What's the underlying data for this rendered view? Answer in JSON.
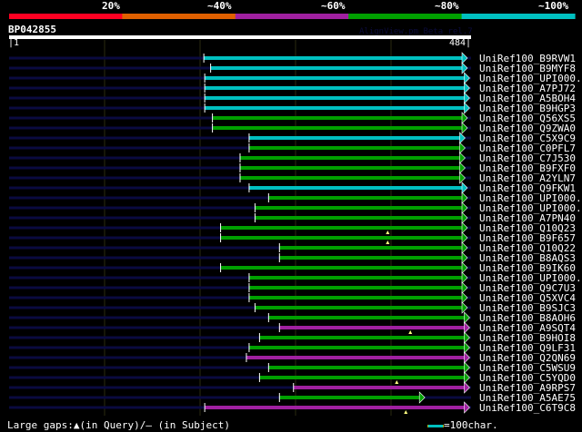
{
  "header": {
    "percent_labels": [
      "20%",
      "~40%",
      "~60%",
      "~80%",
      "~100%"
    ],
    "percent_colors": [
      "#ff0022",
      "#e06000",
      "#a020a0",
      "#00a000",
      "#00c0c0"
    ],
    "query_name": "BP042855",
    "credit": "AlignView.pm Beta rel.7",
    "start": "|1",
    "end": "484|"
  },
  "colors": {
    "cyan": "#00c0c0",
    "green": "#00a000",
    "magenta": "#a020a0",
    "dark": "#0a0a40",
    "grid": "#2a2a10"
  },
  "hits": [
    {
      "name": "UniRef100_B9RVW1",
      "start": 0.43,
      "end": 1.0,
      "color": "cyan"
    },
    {
      "name": "UniRef100_B9MYF8",
      "start": 0.445,
      "end": 1.0,
      "color": "cyan"
    },
    {
      "name": "UniRef100_UPI000..",
      "start": 0.432,
      "end": 1.005,
      "color": "cyan"
    },
    {
      "name": "UniRef100_A7PJ72",
      "start": 0.432,
      "end": 1.005,
      "color": "cyan"
    },
    {
      "name": "UniRef100_A5BOH4",
      "start": 0.432,
      "end": 1.005,
      "color": "cyan"
    },
    {
      "name": "UniRef100_B9HGP3",
      "start": 0.432,
      "end": 1.005,
      "color": "cyan"
    },
    {
      "name": "UniRef100_Q56XS5",
      "start": 0.449,
      "end": 1.0,
      "color": "green"
    },
    {
      "name": "UniRef100_Q9ZWA0",
      "start": 0.449,
      "end": 1.0,
      "color": "green"
    },
    {
      "name": "UniRef100_C5X9C9",
      "start": 0.53,
      "end": 0.995,
      "color": "cyan"
    },
    {
      "name": "UniRef100_C0PFL7",
      "start": 0.53,
      "end": 0.995,
      "color": "green"
    },
    {
      "name": "UniRef100_C7J530",
      "start": 0.51,
      "end": 0.995,
      "color": "green"
    },
    {
      "name": "UniRef100_B9FXF0",
      "start": 0.51,
      "end": 0.995,
      "color": "green"
    },
    {
      "name": "UniRef100_A2YLN7",
      "start": 0.51,
      "end": 0.995,
      "color": "green"
    },
    {
      "name": "UniRef100_Q9FKW1",
      "start": 0.53,
      "end": 1.0,
      "color": "cyan"
    },
    {
      "name": "UniRef100_UPI000..",
      "start": 0.573,
      "end": 1.0,
      "color": "green"
    },
    {
      "name": "UniRef100_UPI000..",
      "start": 0.543,
      "end": 1.0,
      "color": "green"
    },
    {
      "name": "UniRef100_A7PN40",
      "start": 0.543,
      "end": 1.0,
      "color": "green"
    },
    {
      "name": "UniRef100_Q10Q23",
      "start": 0.467,
      "end": 1.0,
      "color": "green",
      "gap": 0.836
    },
    {
      "name": "UniRef100_B9F657",
      "start": 0.467,
      "end": 1.0,
      "color": "green",
      "gap": 0.836
    },
    {
      "name": "UniRef100_Q10Q22",
      "start": 0.597,
      "end": 1.0,
      "color": "green"
    },
    {
      "name": "UniRef100_B8AQS3",
      "start": 0.597,
      "end": 1.0,
      "color": "green"
    },
    {
      "name": "UniRef100_B9IK60",
      "start": 0.467,
      "end": 1.0,
      "color": "green"
    },
    {
      "name": "UniRef100_UPI000..",
      "start": 0.53,
      "end": 1.0,
      "color": "green"
    },
    {
      "name": "UniRef100_Q9C7U3",
      "start": 0.53,
      "end": 1.0,
      "color": "green"
    },
    {
      "name": "UniRef100_Q5XVC4",
      "start": 0.53,
      "end": 1.0,
      "color": "green"
    },
    {
      "name": "UniRef100_B9SJC3",
      "start": 0.543,
      "end": 1.0,
      "color": "green"
    },
    {
      "name": "UniRef100_B8AOH6",
      "start": 0.573,
      "end": 1.005,
      "color": "green"
    },
    {
      "name": "UniRef100_A9SQT4",
      "start": 0.597,
      "end": 1.005,
      "color": "magenta",
      "gap": 0.886
    },
    {
      "name": "UniRef100_B9HOI8",
      "start": 0.553,
      "end": 1.005,
      "color": "green"
    },
    {
      "name": "UniRef100_Q9LF31",
      "start": 0.53,
      "end": 1.005,
      "color": "green"
    },
    {
      "name": "UniRef100_Q2QN69",
      "start": 0.524,
      "end": 1.005,
      "color": "magenta"
    },
    {
      "name": "UniRef100_C5WSU9",
      "start": 0.573,
      "end": 1.005,
      "color": "green"
    },
    {
      "name": "UniRef100_C5YQD0",
      "start": 0.553,
      "end": 1.005,
      "color": "green",
      "gap": 0.856
    },
    {
      "name": "UniRef100_A9RPS7",
      "start": 0.628,
      "end": 1.005,
      "color": "magenta"
    },
    {
      "name": "UniRef100_A5AE75",
      "start": 0.597,
      "end": 0.906,
      "color": "green"
    },
    {
      "name": "UniRef100_C6T9C8",
      "start": 0.432,
      "end": 1.005,
      "color": "magenta",
      "gap": 0.876
    }
  ],
  "legend": {
    "text": "Large gaps:▲(in Query)/– (in Subject)",
    "scale": "=100char."
  }
}
